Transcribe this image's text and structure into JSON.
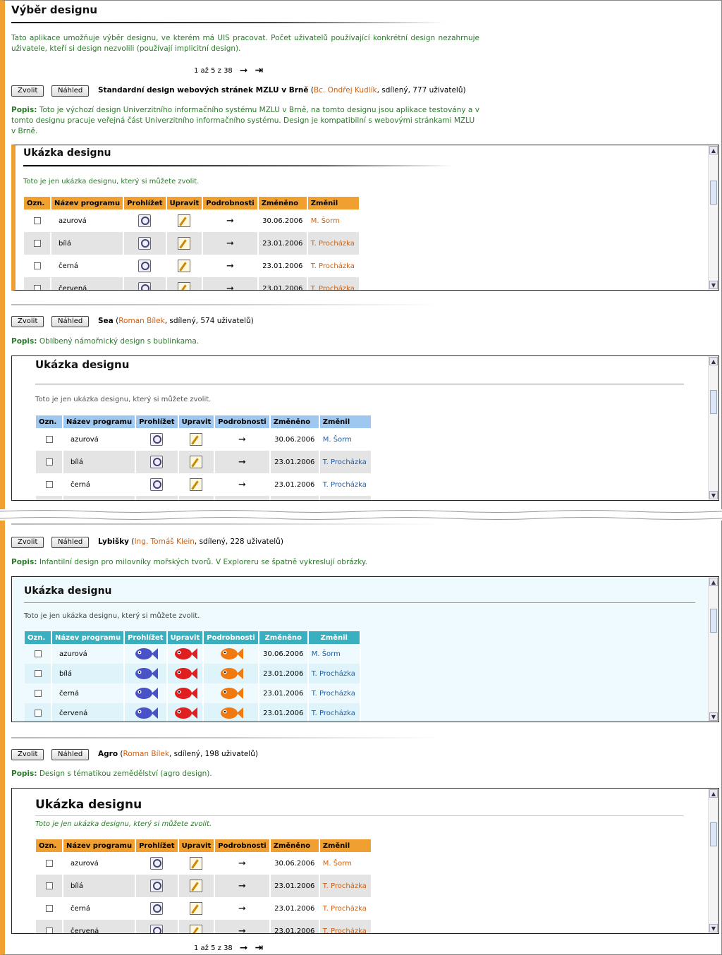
{
  "page": {
    "title": "Výběr designu",
    "intro": "Tato aplikace umožňuje výběr designu, ve kterém má UIS pracovat. Počet uživatelů používající konkrétní design nezahrnuje uživatele, kteří si design nezvolili (používají implicitní design).",
    "pager_text": "1 až 5 z 38",
    "next_icon": "arrow-right-icon",
    "last_icon": "arrow-last-icon"
  },
  "buttons": {
    "choose": "Zvolit",
    "preview": "Náhled"
  },
  "desc_label": "Popis:",
  "designs": [
    {
      "name": "Standardní design webových stránek MZLU v Brně",
      "open": " (",
      "author": "Bc. Ondřej Kudlík",
      "rest": ", sdílený, 777 uživatelů)",
      "description": "Toto je výchozí design Univerzitního informačního systému MZLU v Brně, na tomto designu jsou aplikace testovány a v tomto designu pracuje veřejná část Univerzitního informačního systému. Design je kompatibilní s webovými stránkami MZLU v Brně."
    },
    {
      "name": "Sea",
      "open": " (",
      "author": "Roman Bílek",
      "rest": ", sdílený, 574 uživatelů)",
      "description": "Oblíbený námořnický design s bublinkama."
    },
    {
      "name": "Lybišky",
      "open": " (",
      "author": "Ing. Tomáš Klein",
      "rest": ", sdílený, 228 uživatelů)",
      "description": "Infantilní design pro milovníky mořských tvorů. V Exploreru se špatně vykreslují obrázky."
    },
    {
      "name": "Agro",
      "open": " (",
      "author": "Roman Bílek",
      "rest": ", sdílený, 198 uživatelů)",
      "description": "Design s tématikou zemědělství (agro design)."
    }
  ],
  "preview": {
    "title": "Ukázka designu",
    "text": "Toto je jen ukázka designu, který si můžete zvolit.",
    "columns": [
      "Ozn.",
      "Název programu",
      "Prohlížet",
      "Upravit",
      "Podrobnosti",
      "Změněno",
      "Změnil"
    ],
    "rows": [
      {
        "name": "azurová",
        "date": "30.06.2006",
        "by": "M. Šorm"
      },
      {
        "name": "bílá",
        "date": "23.01.2006",
        "by": "T. Procházka"
      },
      {
        "name": "černá",
        "date": "23.01.2006",
        "by": "T. Procházka"
      },
      {
        "name": "červená",
        "date": "23.01.2006",
        "by": "T. Procházka"
      }
    ]
  },
  "colors": {
    "accent": "#f0a030",
    "green_text": "#2a7a2a",
    "author": "#d06010",
    "sea_header": "#9ec8f0",
    "sea_link": "#1a5fb0",
    "fish_header": "#38b0c0",
    "fish_bg": "#eefafd",
    "agro_header": "#f0a030"
  }
}
